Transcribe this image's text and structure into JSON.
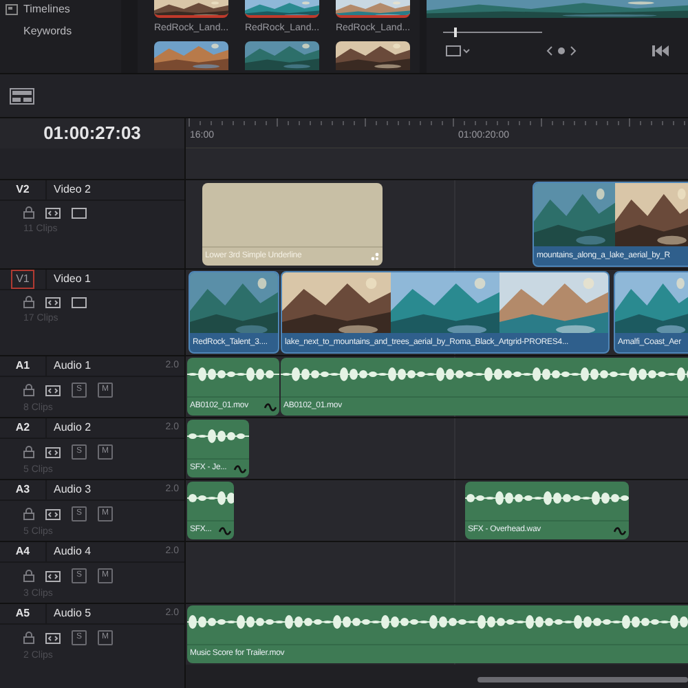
{
  "sidebar": {
    "items": [
      {
        "label": "Timelines",
        "kind": "folder"
      },
      {
        "label": "Keywords",
        "kind": "plain"
      }
    ]
  },
  "media_pool": {
    "clips": [
      {
        "label": "RedRock_Land...",
        "kind": "picture"
      },
      {
        "label": "RedRock_Land...",
        "kind": "picture"
      },
      {
        "label": "RedRock_Land...",
        "kind": "picture"
      }
    ]
  },
  "viewer": {
    "scrubber": {
      "level": 0.11
    }
  },
  "timeline": {
    "timecode": "01:00:27:03",
    "ruler_labels": [
      "16:00",
      "01:00:20:00"
    ],
    "tracks": [
      {
        "id": "V2",
        "name": "Video 2",
        "kind": "video",
        "selected": false,
        "clip_count": "11 Clips",
        "clips": [
          {
            "label": "Lower 3rd Simple Underline",
            "kind": "title",
            "fade_icon": false
          },
          {
            "label": "mountains_along_a_lake_aerial_by_R",
            "kind": "video",
            "fade_icon": false
          }
        ]
      },
      {
        "id": "V1",
        "name": "Video 1",
        "kind": "video",
        "selected": true,
        "clip_count": "17 Clips",
        "clips": [
          {
            "label": "RedRock_Talent_3....",
            "kind": "video",
            "fade_icon": false
          },
          {
            "label": "lake_next_to_mountains_and_trees_aerial_by_Roma_Black_Artgrid-PRORES4...",
            "kind": "video",
            "fade_icon": false
          },
          {
            "label": "Amalfi_Coast_Aer",
            "kind": "video",
            "fade_icon": false
          }
        ]
      },
      {
        "id": "A1",
        "name": "Audio 1",
        "kind": "audio",
        "selected": false,
        "channels": "2.0",
        "buttons": [
          "S",
          "M"
        ],
        "clip_count": "8 Clips",
        "clips": [
          {
            "label": "AB0102_01.mov",
            "kind": "audio",
            "fade_icon": true
          },
          {
            "label": "AB0102_01.mov",
            "kind": "audio",
            "fade_icon": false
          }
        ]
      },
      {
        "id": "A2",
        "name": "Audio 2",
        "kind": "audio",
        "selected": false,
        "channels": "2.0",
        "buttons": [
          "S",
          "M"
        ],
        "clip_count": "5 Clips",
        "clips": [
          {
            "label": "SFX - Je...",
            "kind": "audio",
            "fade_icon": true
          }
        ]
      },
      {
        "id": "A3",
        "name": "Audio 3",
        "kind": "audio",
        "selected": false,
        "channels": "2.0",
        "buttons": [
          "S",
          "M"
        ],
        "clip_count": "5 Clips",
        "clips": [
          {
            "label": "SFX...",
            "kind": "audio",
            "fade_icon": true
          },
          {
            "label": "SFX - Overhead.wav",
            "kind": "audio",
            "fade_icon": true
          }
        ]
      },
      {
        "id": "A4",
        "name": "Audio 4",
        "kind": "audio",
        "selected": false,
        "channels": "2.0",
        "buttons": [
          "S",
          "M"
        ],
        "clip_count": "3 Clips"
      },
      {
        "id": "A5",
        "name": "Audio 5",
        "kind": "audio",
        "selected": false,
        "channels": "2.0",
        "buttons": [
          "S",
          "M"
        ],
        "clip_count": "2 Clips",
        "clips": [
          {
            "label": "Music Score for Trailer.mov",
            "kind": "audio",
            "fade_icon": false
          }
        ]
      }
    ]
  }
}
